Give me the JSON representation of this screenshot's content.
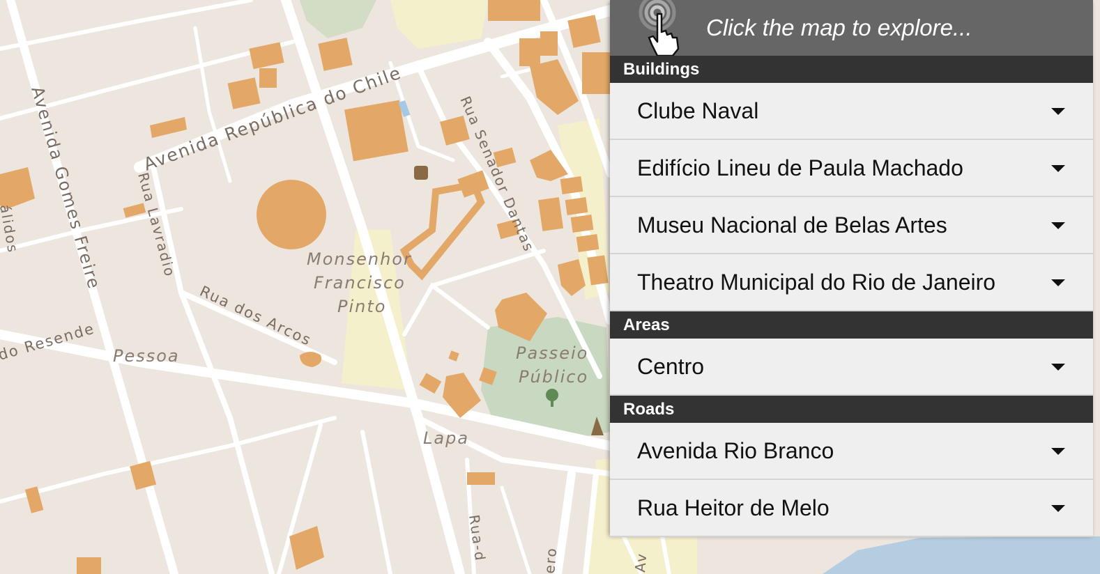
{
  "map": {
    "street_labels": [
      "Avenida República do Chile",
      "Avenida Gomes Freire",
      "Rua Lavradio",
      "Rua dos Arcos",
      "Rua Senador Dantas",
      "do Resende",
      "álidos",
      "Rua-d",
      "ero",
      "Av"
    ],
    "place_labels": [
      "Monsenhor",
      "Francisco",
      "Pinto",
      "Pessoa",
      "Passeio",
      "Público",
      "Lapa"
    ],
    "colors": {
      "land": "#ede6df",
      "road": "#ffffff",
      "building": "#e3a868",
      "park": "#c9d8c0",
      "sand": "#f5f0cc",
      "water": "#b5cde0"
    }
  },
  "panel": {
    "header": {
      "text": "Click the map to explore...",
      "icon": "pointer-hand-icon"
    },
    "sections": [
      {
        "title": "Buildings",
        "items": [
          "Clube Naval",
          "Edifício Lineu de Paula Machado",
          "Museu Nacional de Belas Artes",
          "Theatro Municipal do Rio de Janeiro"
        ]
      },
      {
        "title": "Areas",
        "items": [
          "Centro"
        ]
      },
      {
        "title": "Roads",
        "items": [
          "Avenida Rio Branco",
          "Rua Heitor de Melo"
        ]
      }
    ]
  }
}
